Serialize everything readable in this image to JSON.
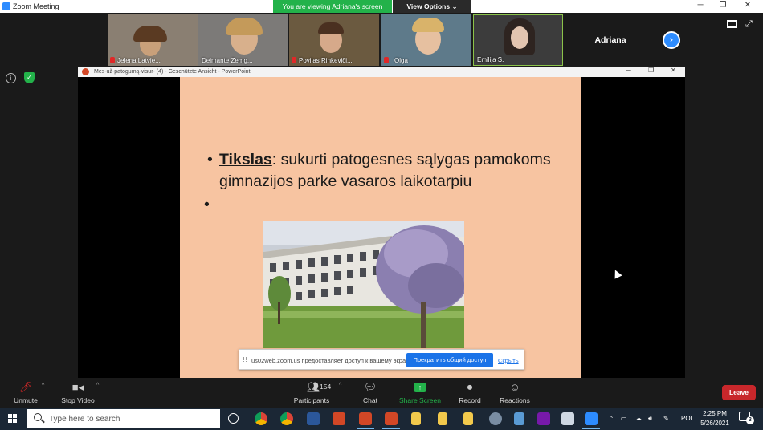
{
  "window": {
    "title": "Zoom Meeting"
  },
  "banner": {
    "viewing": "You are viewing Adriana's screen",
    "view_options": "View Options ⌄"
  },
  "participants": [
    {
      "name": "Jelena Latvie...",
      "muted": true
    },
    {
      "name": "Deimante Zemg...",
      "muted": false
    },
    {
      "name": "Povilas Rinkeviči...",
      "muted": true
    },
    {
      "name": "Olga",
      "muted": true
    },
    {
      "name": "Emilija S.",
      "muted": false
    }
  ],
  "active_speaker": "Adriana",
  "ppt": {
    "title": "Mes-už-patogumą-visur- (4)  -  Geschützte Ansicht  -  PowerPoint"
  },
  "slide": {
    "keyword": "Tikslas",
    "text": ": sukurti patogesnes sąlygas pamokoms gimnazijos parke vasaros laikotarpiu",
    "bullet_char": "•"
  },
  "share_notice": {
    "message": "us02web.zoom.us предоставляет доступ к вашему экрану.",
    "stop": "Прекратить общий доступ",
    "hide": "Скрыть"
  },
  "toolbar": {
    "unmute": "Unmute",
    "stop_video": "Stop Video",
    "participants_count": "154",
    "participants": "Participants",
    "chat": "Chat",
    "share_screen": "Share Screen",
    "record": "Record",
    "reactions": "Reactions",
    "leave": "Leave"
  },
  "taskbar": {
    "search_placeholder": "Type here to search",
    "lang": "POL",
    "time": "2:25 PM",
    "date": "5/26/2021",
    "notifications": "3"
  },
  "colors": {
    "zoom_blue": "#2d8cff",
    "share_green": "#23b24a",
    "leave_red": "#c8272b",
    "slide_bg": "#f7c4a1"
  }
}
